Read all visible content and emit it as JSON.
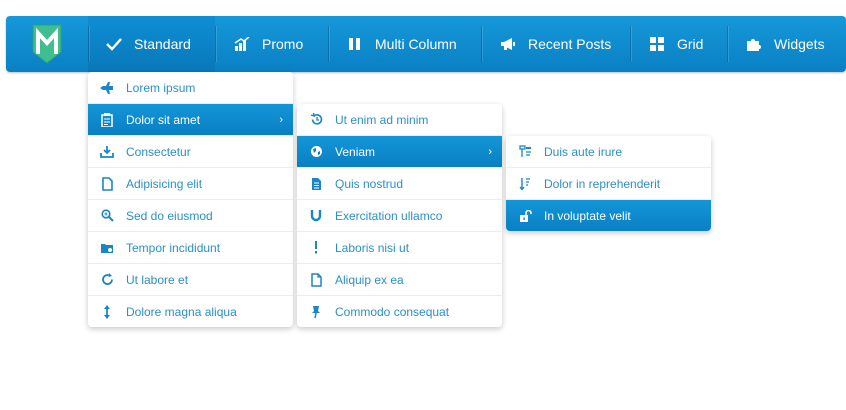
{
  "colors": {
    "accent": "#0b86c9",
    "link": "#2a8fc9"
  },
  "nav": {
    "items": [
      {
        "label": "Standard",
        "icon": "check-icon"
      },
      {
        "label": "Promo",
        "icon": "bar-chart-icon"
      },
      {
        "label": "Multi Column",
        "icon": "columns-icon"
      },
      {
        "label": "Recent Posts",
        "icon": "megaphone-icon"
      },
      {
        "label": "Grid",
        "icon": "grid-icon"
      },
      {
        "label": "Widgets",
        "icon": "puzzle-icon"
      }
    ]
  },
  "menu1": {
    "items": [
      {
        "label": "Lorem ipsum",
        "icon": "plane-icon"
      },
      {
        "label": "Dolor sit amet",
        "icon": "clipboard-icon"
      },
      {
        "label": "Consectetur",
        "icon": "download-icon"
      },
      {
        "label": "Adipisicing elit",
        "icon": "document-icon"
      },
      {
        "label": "Sed do eiusmod",
        "icon": "zoom-icon"
      },
      {
        "label": "Tempor incididunt",
        "icon": "folder-icon"
      },
      {
        "label": "Ut labore et",
        "icon": "refresh-icon"
      },
      {
        "label": "Dolore magna aliqua",
        "icon": "resize-vertical-icon"
      }
    ]
  },
  "menu2": {
    "items": [
      {
        "label": "Ut enim ad minim",
        "icon": "history-icon"
      },
      {
        "label": "Veniam",
        "icon": "globe-icon"
      },
      {
        "label": "Quis nostrud",
        "icon": "file-text-icon"
      },
      {
        "label": "Exercitation ullamco",
        "icon": "magnet-icon"
      },
      {
        "label": "Laboris nisi ut",
        "icon": "exclamation-icon"
      },
      {
        "label": "Aliquip ex ea",
        "icon": "file-icon"
      },
      {
        "label": "Commodo consequat",
        "icon": "pushpin-icon"
      }
    ]
  },
  "menu3": {
    "items": [
      {
        "label": "Duis aute irure",
        "icon": "filter-icon"
      },
      {
        "label": "Dolor in reprehenderit",
        "icon": "sort-icon"
      },
      {
        "label": "In voluptate velit",
        "icon": "unlock-icon"
      }
    ]
  }
}
